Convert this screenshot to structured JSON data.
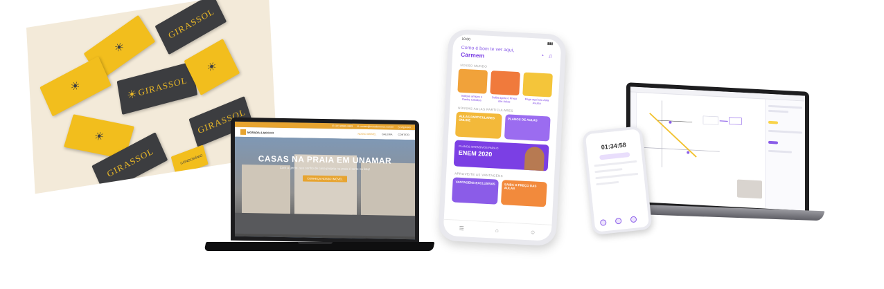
{
  "business_cards": {
    "brand": "GIRASSOL",
    "brand_sub": "CONDOMÍNIO",
    "sun_glyph": "☀",
    "colors": {
      "dark": "#3c3d40",
      "yellow": "#f2be1d",
      "background": "#f3ead9"
    }
  },
  "laptop_site": {
    "topbar_items": [
      "✆ (22) 99999-9999",
      "✉ contato@moradamocco.com.br",
      "◷ seg a sex"
    ],
    "logo_text": "MORADA & MOCCO",
    "nav": [
      "NOSSO IMÓVEL",
      "GALERIA",
      "CONTATO"
    ],
    "hero_title": "CASAS NA PRAIA EM UNAMAR",
    "hero_subtitle": "Com a gente, seu sonho de casa própria na praia é certo na lista!",
    "cta_label": "CONHEÇA NOSSO IMÓVEL",
    "accent": "#e7a430"
  },
  "phone_app": {
    "time": "10:00",
    "greeting": "Como é bom te ver aqui,",
    "user_name": "Carmem",
    "header_icons": "◔ ♫",
    "section_1": "NOSSO MUNDO",
    "tiles": [
      {
        "label": "Indique amigos e Ganhe Créditos",
        "color": "#f1a23a"
      },
      {
        "label": "Saiba agora o Preço das Aulas",
        "color": "#f07a3c"
      },
      {
        "label": "Pega aqui seu Aula Avulsa",
        "color": "#f4c53a"
      }
    ],
    "section_2": "NOSSAS AULAS PARTICULARES",
    "big_tiles": [
      {
        "label": "AULAS PARTICULARES ONLINE",
        "color": "#f3b93a"
      },
      {
        "label": "PLANOS DE AULAS",
        "color": "#9b6cf0"
      }
    ],
    "banner_small": "PLANOS INTENSIVOS PARA O",
    "banner_big": "ENEM 2020",
    "section_3": "APROVEITE AS VANTAGENS",
    "bottom_tiles": [
      {
        "label": "VANTAGENS EXCLUSIVAS",
        "color": "#8b5ce8"
      },
      {
        "label": "SAIBA O PREÇO DAS AULAS",
        "color": "#f28a3c"
      }
    ],
    "nav_icons": [
      "☰",
      "⌂",
      "☺"
    ]
  },
  "small_phone": {
    "timer": "01:34:58",
    "accent": "#8a5de8"
  }
}
